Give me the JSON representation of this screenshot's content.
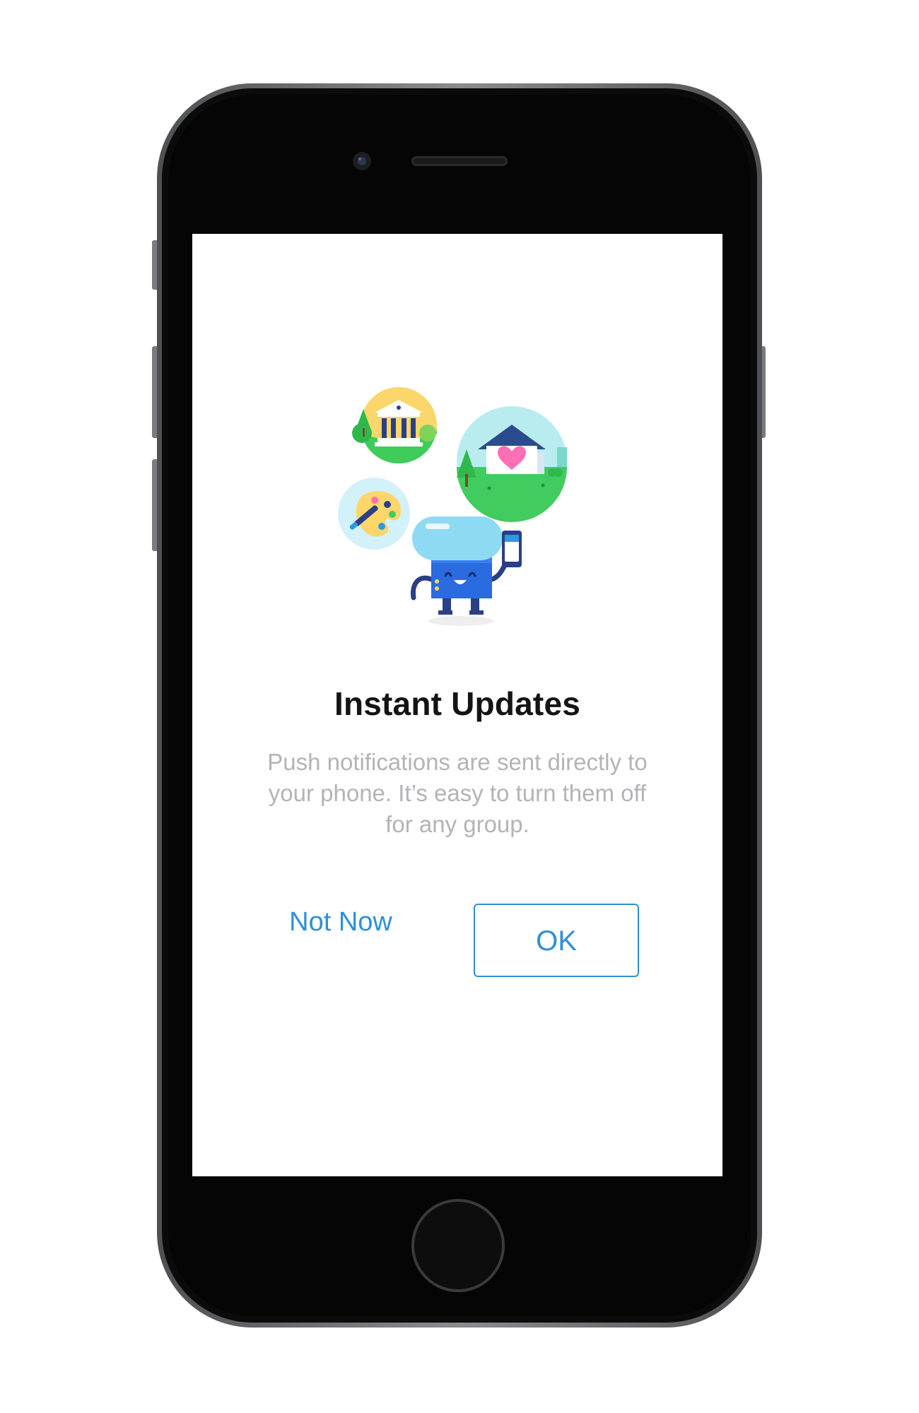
{
  "dialog": {
    "title": "Instant Updates",
    "message": "Push notifications are sent directly to your phone. It’s easy to turn them off for any group.",
    "secondary_label": "Not Now",
    "primary_label": "OK"
  },
  "illustration": {
    "icons": [
      "museum-icon",
      "home-heart-icon",
      "paint-palette-icon",
      "robot-mascot-icon"
    ]
  },
  "colors": {
    "accent": "#2f8fd8",
    "title": "#141414",
    "body": "#b3b3b8",
    "phone_bezel": "#0a0a0a",
    "phone_frame": "#6b6d70"
  }
}
